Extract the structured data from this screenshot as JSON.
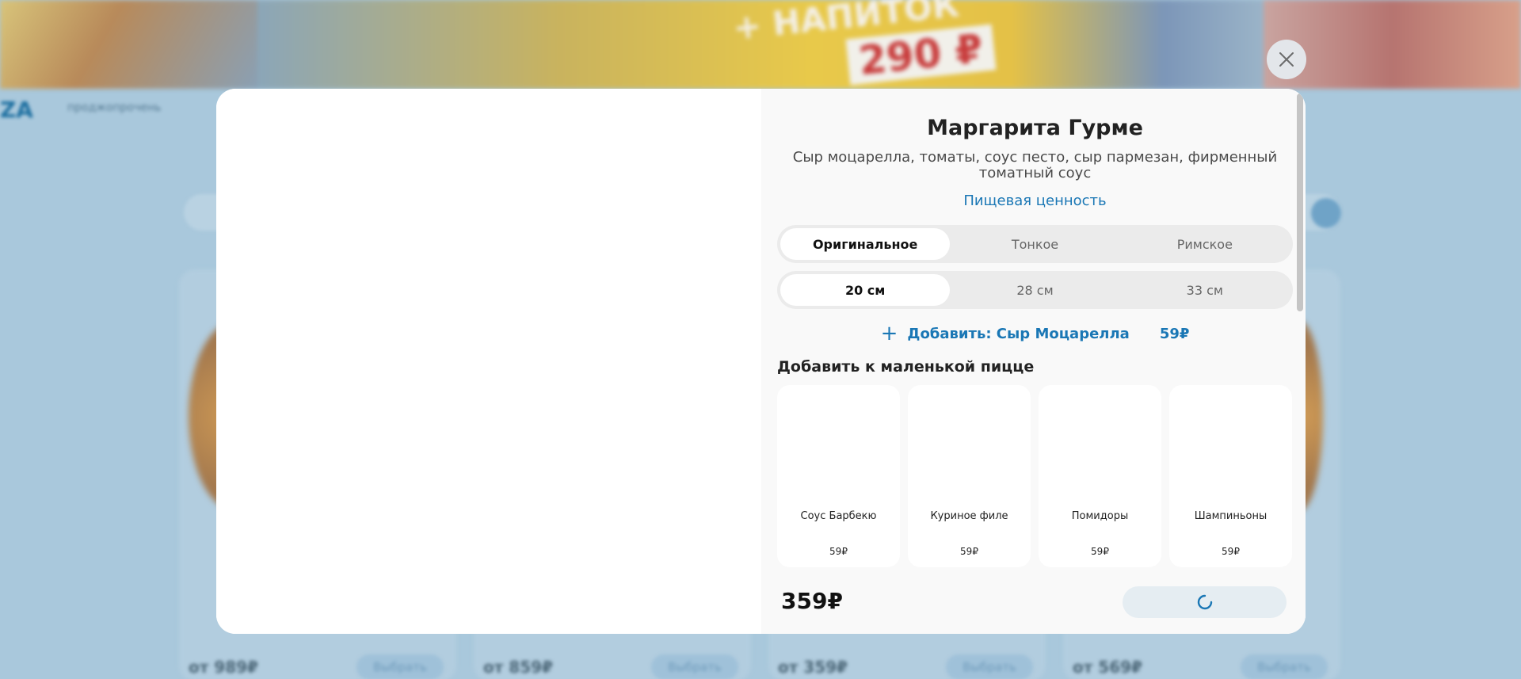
{
  "background": {
    "promo_text": "+ НАПИТОК",
    "promo_price": "290 ₽",
    "logo": "ZA",
    "nav_text": "проджопрочень",
    "card_prices": [
      "от 989₽",
      "от 859₽",
      "от 359₽",
      "от 569₽"
    ],
    "card_button_label": "Выбрать"
  },
  "product": {
    "title": "Маргарита Гурме",
    "description": "Сыр моцарелла, томаты, соус песто, сыр пармезан, фирменный томатный соус",
    "nutrition_link": "Пищевая ценность"
  },
  "dough_options": [
    {
      "label": "Оригинальное",
      "active": true
    },
    {
      "label": "Тонкое",
      "active": false
    },
    {
      "label": "Римское",
      "active": false
    }
  ],
  "size_options": [
    {
      "label": "20 см",
      "active": true
    },
    {
      "label": "28 см",
      "active": false
    },
    {
      "label": "33 см",
      "active": false
    }
  ],
  "add_topping": {
    "label": "Добавить: Сыр Моцарелла",
    "price": "59₽"
  },
  "extras_section_title": "Добавить к маленькой пицце",
  "extras": [
    {
      "name": "Соус Барбекю",
      "price": "59₽"
    },
    {
      "name": "Куриное филе",
      "price": "59₽"
    },
    {
      "name": "Помидоры",
      "price": "59₽"
    },
    {
      "name": "Шампиньоны",
      "price": "59₽"
    }
  ],
  "footer": {
    "total": "359₽",
    "cart_button_state": "loading"
  },
  "colors": {
    "accent": "#1a77b5",
    "panel_bg": "#f9f9f9",
    "overlay_bg": "#a9c8dc"
  },
  "icons": {
    "close": "close-icon",
    "plus": "plus-icon",
    "spinner": "loading-spinner-icon"
  }
}
